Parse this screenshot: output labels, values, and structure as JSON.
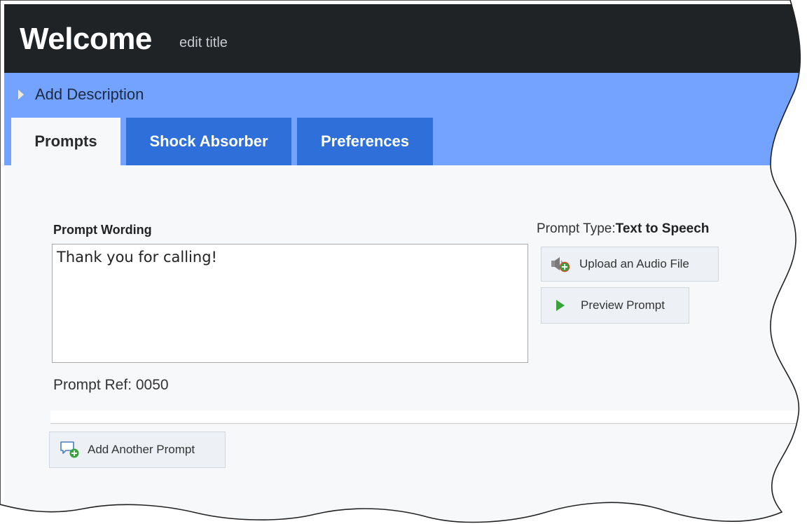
{
  "header": {
    "title": "Welcome",
    "edit_title_link": "edit title"
  },
  "description": {
    "toggle_label": "Add Description"
  },
  "tabs": [
    {
      "label": "Prompts",
      "active": true
    },
    {
      "label": "Shock Absorber",
      "active": false
    },
    {
      "label": "Preferences",
      "active": false
    }
  ],
  "prompt": {
    "wording_label": "Prompt Wording",
    "wording_value": "Thank you for calling!",
    "type_label": "Prompt Type:",
    "type_value": "Text to Speech",
    "ref_text": "Prompt Ref: 0050",
    "upload_label": "Upload an Audio File",
    "preview_label": "Preview Prompt"
  },
  "actions": {
    "add_prompt_label": "Add Another Prompt"
  },
  "icons": {
    "description_toggle": "triangle-right-icon",
    "upload": "speaker-add-icon",
    "preview": "play-icon",
    "add_prompt": "speech-bubble-add-icon"
  },
  "colors": {
    "header_bg": "#1f2326",
    "description_bar": "#74a3ff",
    "tab_inactive": "#2f6fd9",
    "content_bg": "#f7f8fa"
  }
}
